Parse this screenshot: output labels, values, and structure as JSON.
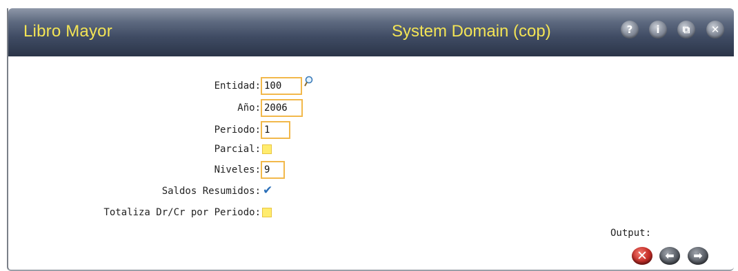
{
  "window": {
    "title": "Libro Mayor",
    "domain": "System Domain (cop)",
    "buttons": {
      "help": "?",
      "info": "i",
      "restore": "⧉",
      "close": "✕"
    }
  },
  "form": {
    "entidad": {
      "label": "Entidad:",
      "value": "100"
    },
    "anio": {
      "label": "Año:",
      "value": "2006"
    },
    "periodo": {
      "label": "Periodo:",
      "value": "1"
    },
    "parcial": {
      "label": "Parcial:",
      "checked": false
    },
    "niveles": {
      "label": "Niveles:",
      "value": "9"
    },
    "saldos_resumidos": {
      "label": "Saldos Resumidos:",
      "checked": true
    },
    "totaliza": {
      "label": "Totaliza Dr/Cr por Periodo:",
      "checked": false
    }
  },
  "output": {
    "label": "Output:",
    "icons": [
      "cancel-icon",
      "back-arrow-icon",
      "forward-arrow-icon"
    ]
  },
  "colors": {
    "title_text": "#f3e455",
    "field_border": "#f2b84a",
    "checkbox_fill": "#ffec6e",
    "checkmark": "#2b6fb8",
    "cancel": "#c8302a"
  }
}
